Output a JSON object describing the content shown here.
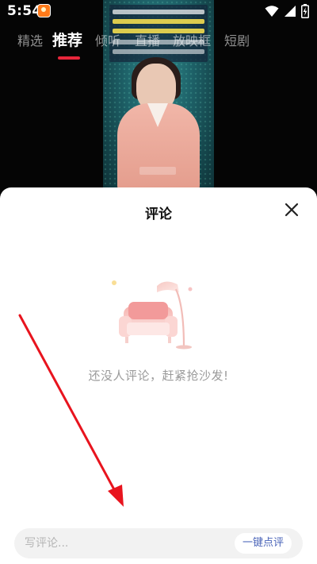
{
  "status_bar": {
    "time": "5:54",
    "icons": [
      "app-notification-icon",
      "wifi-icon",
      "cellular-signal-icon",
      "battery-charging-icon"
    ]
  },
  "top_tabs": [
    {
      "label": "精选",
      "active": false
    },
    {
      "label": "推荐",
      "active": true
    },
    {
      "label": "倾听",
      "active": false
    },
    {
      "label": "直播",
      "active": false
    },
    {
      "label": "放映框",
      "active": false
    },
    {
      "label": "短剧",
      "active": false
    }
  ],
  "comment_sheet": {
    "title": "评论",
    "empty_message": "还没人评论，赶紧抢沙发!",
    "input_placeholder": "写评论...",
    "quick_comment_label": "一键点评"
  },
  "colors": {
    "tab_underline": "#e8263b",
    "quick_comment_text": "#4a64b8",
    "annotation_arrow": "#e8141e",
    "illustration_pink": "#f29a9a"
  }
}
